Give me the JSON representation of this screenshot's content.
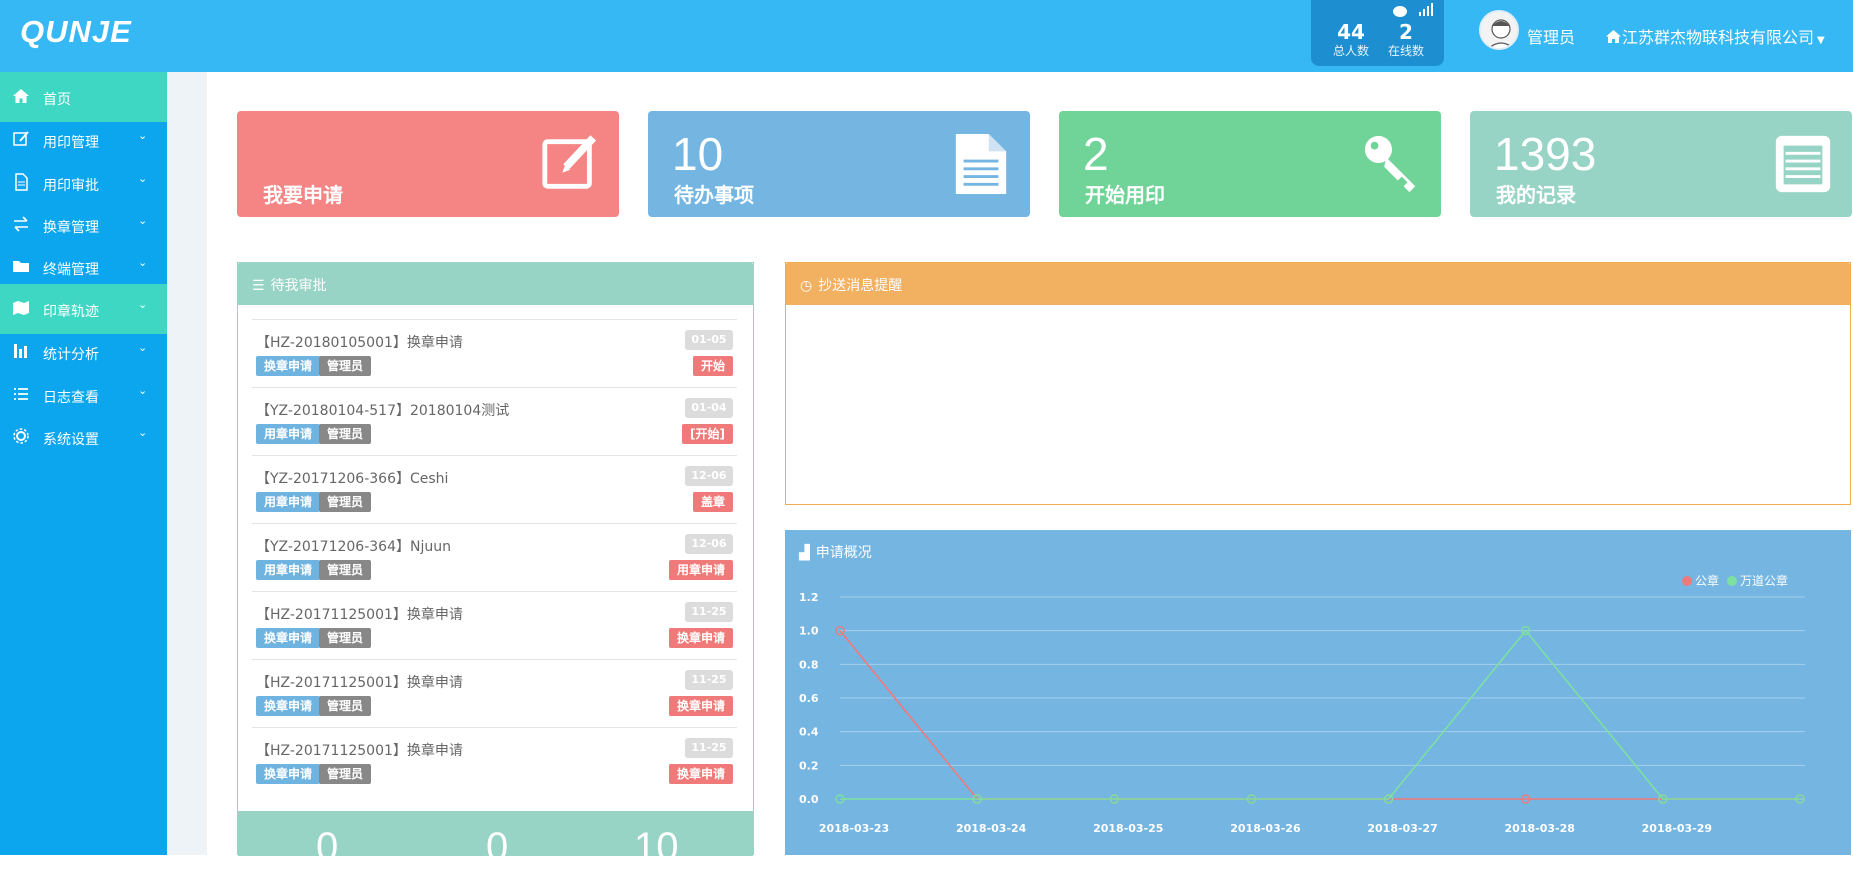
{
  "header": {
    "logo": "QUNJE",
    "stats": {
      "total_value": "44",
      "total_label": "总人数",
      "online_value": "2",
      "online_label": "在线数"
    },
    "user_name": "管理员",
    "company": "江苏群杰物联科技有限公司"
  },
  "sidebar": {
    "items": [
      {
        "label": "首页",
        "icon": "home-icon",
        "active": true
      },
      {
        "label": "用印管理",
        "icon": "edit-icon"
      },
      {
        "label": "用印审批",
        "icon": "document-icon"
      },
      {
        "label": "换章管理",
        "icon": "exchange-icon"
      },
      {
        "label": "终端管理",
        "icon": "folder-icon"
      },
      {
        "label": "印章轨迹",
        "icon": "map-icon",
        "active": true
      },
      {
        "label": "统计分析",
        "icon": "bar-chart-icon"
      },
      {
        "label": "日志查看",
        "icon": "list-icon"
      },
      {
        "label": "系统设置",
        "icon": "gear-icon"
      }
    ]
  },
  "tiles": [
    {
      "number": "",
      "label": "我要申请",
      "color": "#f58485",
      "icon": "edit-square-icon"
    },
    {
      "number": "10",
      "label": "待办事项",
      "color": "#74b5e2",
      "icon": "file-text-icon"
    },
    {
      "number": "2",
      "label": "开始用印",
      "color": "#70d398",
      "icon": "key-icon"
    },
    {
      "number": "1393",
      "label": "我的记录",
      "color": "#98d4c5",
      "icon": "list-alt-icon"
    }
  ],
  "todo": {
    "title": "待我审批",
    "items": [
      {
        "title": "【HZ-20180105001】换章申请",
        "date": "01-05",
        "type": "换章申请",
        "user": "管理员",
        "status": "开始"
      },
      {
        "title": "【YZ-20180104-517】20180104测试",
        "date": "01-04",
        "type": "用章申请",
        "user": "管理员",
        "status": "[开始]"
      },
      {
        "title": "【YZ-20171206-366】Ceshi",
        "date": "12-06",
        "type": "用章申请",
        "user": "管理员",
        "status": "盖章"
      },
      {
        "title": "【YZ-20171206-364】Njuun",
        "date": "12-06",
        "type": "用章申请",
        "user": "管理员",
        "status": "用章申请"
      },
      {
        "title": "【HZ-20171125001】换章申请",
        "date": "11-25",
        "type": "换章申请",
        "user": "管理员",
        "status": "换章申请"
      },
      {
        "title": "【HZ-20171125001】换章申请",
        "date": "11-25",
        "type": "换章申请",
        "user": "管理员",
        "status": "换章申请"
      },
      {
        "title": "【HZ-20171125001】换章申请",
        "date": "11-25",
        "type": "换章申请",
        "user": "管理员",
        "status": "换章申请"
      }
    ],
    "footer_values": [
      "0",
      "0",
      "10"
    ]
  },
  "notice": {
    "title": "抄送消息提醒"
  },
  "chart_panel": {
    "title": "申请概况"
  },
  "chart_data": {
    "type": "line",
    "categories": [
      "2018-03-23",
      "2018-03-24",
      "2018-03-25",
      "2018-03-26",
      "2018-03-27",
      "2018-03-28",
      "2018-03-29",
      ""
    ],
    "series": [
      {
        "name": "公章",
        "color": "#f07a7a",
        "values": [
          1,
          0,
          0,
          0,
          0,
          0,
          0,
          0
        ]
      },
      {
        "name": "万道公章",
        "color": "#7ee0a0",
        "values": [
          0,
          0,
          0,
          0,
          0,
          1,
          0,
          0
        ]
      }
    ],
    "yticks": [
      "0.0",
      "0.2",
      "0.4",
      "0.6",
      "0.8",
      "1.0",
      "1.2"
    ],
    "ylim": [
      0,
      1.2
    ],
    "legend": "top-right",
    "grid": true
  }
}
